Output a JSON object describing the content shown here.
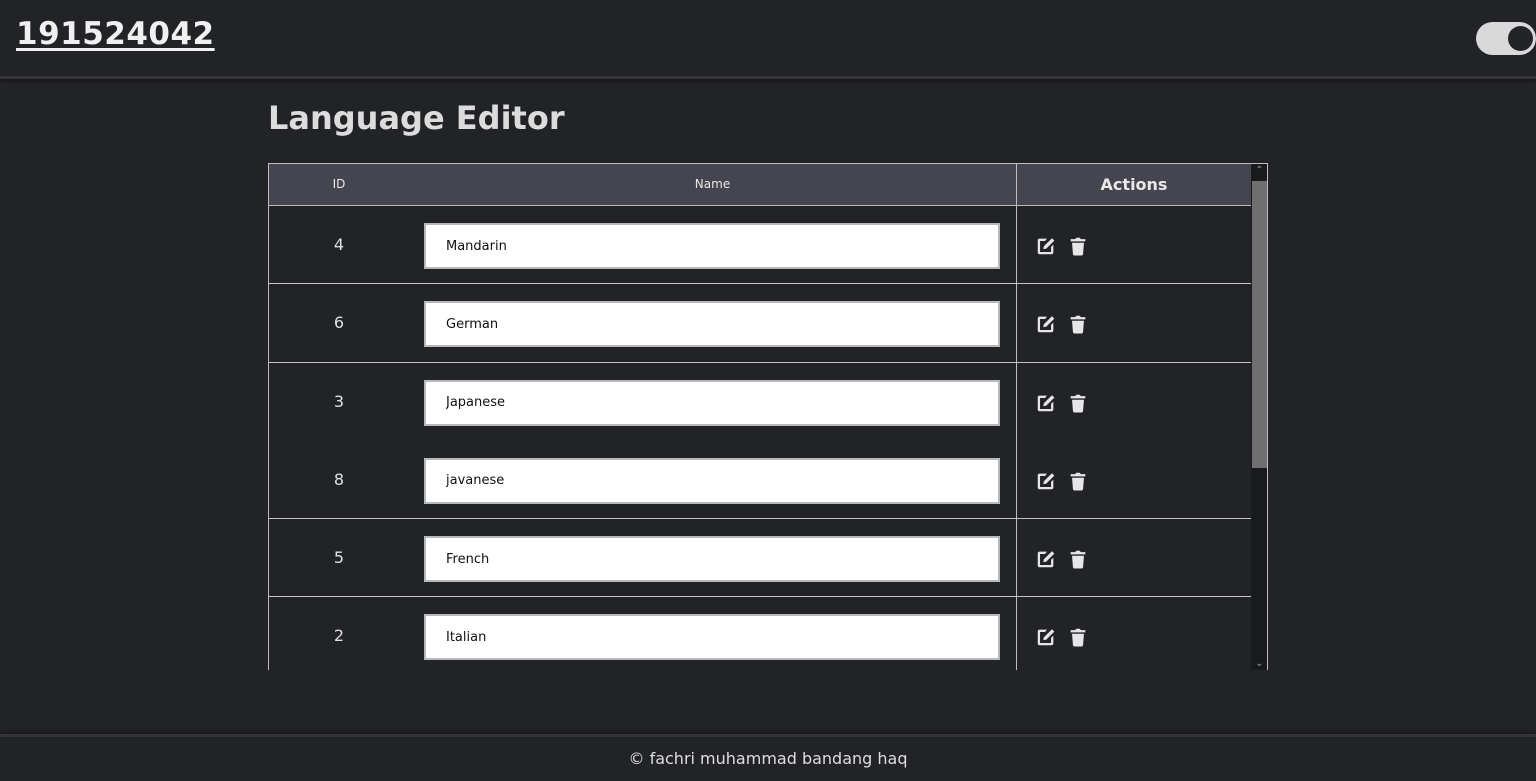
{
  "header": {
    "brand": "191524042",
    "theme_toggle": "on"
  },
  "main": {
    "title": "Language Editor"
  },
  "table": {
    "columns": {
      "id": "ID",
      "name": "Name",
      "actions": "Actions"
    },
    "rows": [
      {
        "id": "4",
        "name": "Mandarin"
      },
      {
        "id": "6",
        "name": "German"
      },
      {
        "id": "3",
        "name": "Japanese"
      },
      {
        "id": "8",
        "name": "javanese"
      },
      {
        "id": "5",
        "name": "French"
      },
      {
        "id": "2",
        "name": "Italian"
      }
    ],
    "action_icons": [
      "edit-icon",
      "trash-icon"
    ]
  },
  "footer": {
    "text": "© fachri muhammad bandang haq"
  }
}
